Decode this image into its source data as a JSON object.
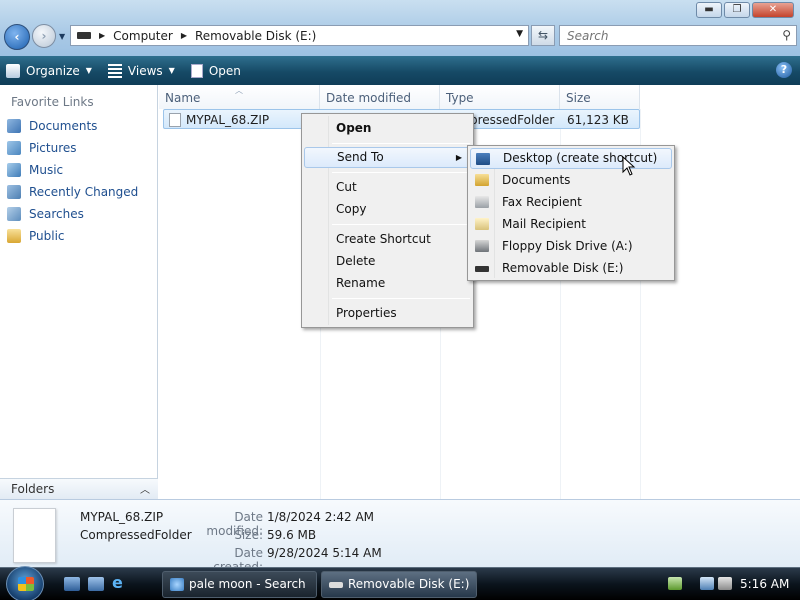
{
  "window": {
    "min_label": "▬",
    "max_label": "❐",
    "close_label": "✕"
  },
  "address": {
    "crumbs": [
      "Computer",
      "Removable Disk (E:)"
    ]
  },
  "search": {
    "placeholder": "Search"
  },
  "toolbar": {
    "organize": "Organize",
    "views": "Views",
    "open": "Open",
    "help": "?"
  },
  "nav": {
    "heading": "Favorite Links",
    "items": [
      {
        "label": "Documents",
        "icon": "documents-icon"
      },
      {
        "label": "Pictures",
        "icon": "pictures-icon"
      },
      {
        "label": "Music",
        "icon": "music-icon"
      },
      {
        "label": "Recently Changed",
        "icon": "recently-changed-icon"
      },
      {
        "label": "Searches",
        "icon": "searches-icon"
      },
      {
        "label": "Public",
        "icon": "public-folder-icon"
      }
    ],
    "folders": "Folders"
  },
  "columns": [
    "Name",
    "Date modified",
    "Type",
    "Size"
  ],
  "file": {
    "name": "MYPAL_68.ZIP",
    "type_visible": "pressedFolder",
    "size": "61,123 KB"
  },
  "context_menu": {
    "items": [
      "Open",
      "Send To",
      "Cut",
      "Copy",
      "Create Shortcut",
      "Delete",
      "Rename",
      "Properties"
    ]
  },
  "send_to": {
    "items": [
      {
        "label": "Desktop (create shortcut)",
        "icon": "desktop-icon"
      },
      {
        "label": "Documents",
        "icon": "documents-folder-icon"
      },
      {
        "label": "Fax Recipient",
        "icon": "fax-icon"
      },
      {
        "label": "Mail Recipient",
        "icon": "mail-icon"
      },
      {
        "label": "Floppy Disk Drive (A:)",
        "icon": "floppy-drive-icon"
      },
      {
        "label": "Removable Disk (E:)",
        "icon": "removable-disk-icon"
      }
    ]
  },
  "details": {
    "name": "MYPAL_68.ZIP",
    "type": "CompressedFolder",
    "modified_label": "Date modified:",
    "modified": "1/8/2024 2:42 AM",
    "size_label": "Size:",
    "size": "59.6 MB",
    "created_label": "Date created:",
    "created": "9/28/2024 5:14 AM"
  },
  "taskbar": {
    "tasks": [
      "pale moon - Search ...",
      "Removable Disk (E:)"
    ],
    "clock": "5:16 AM"
  }
}
